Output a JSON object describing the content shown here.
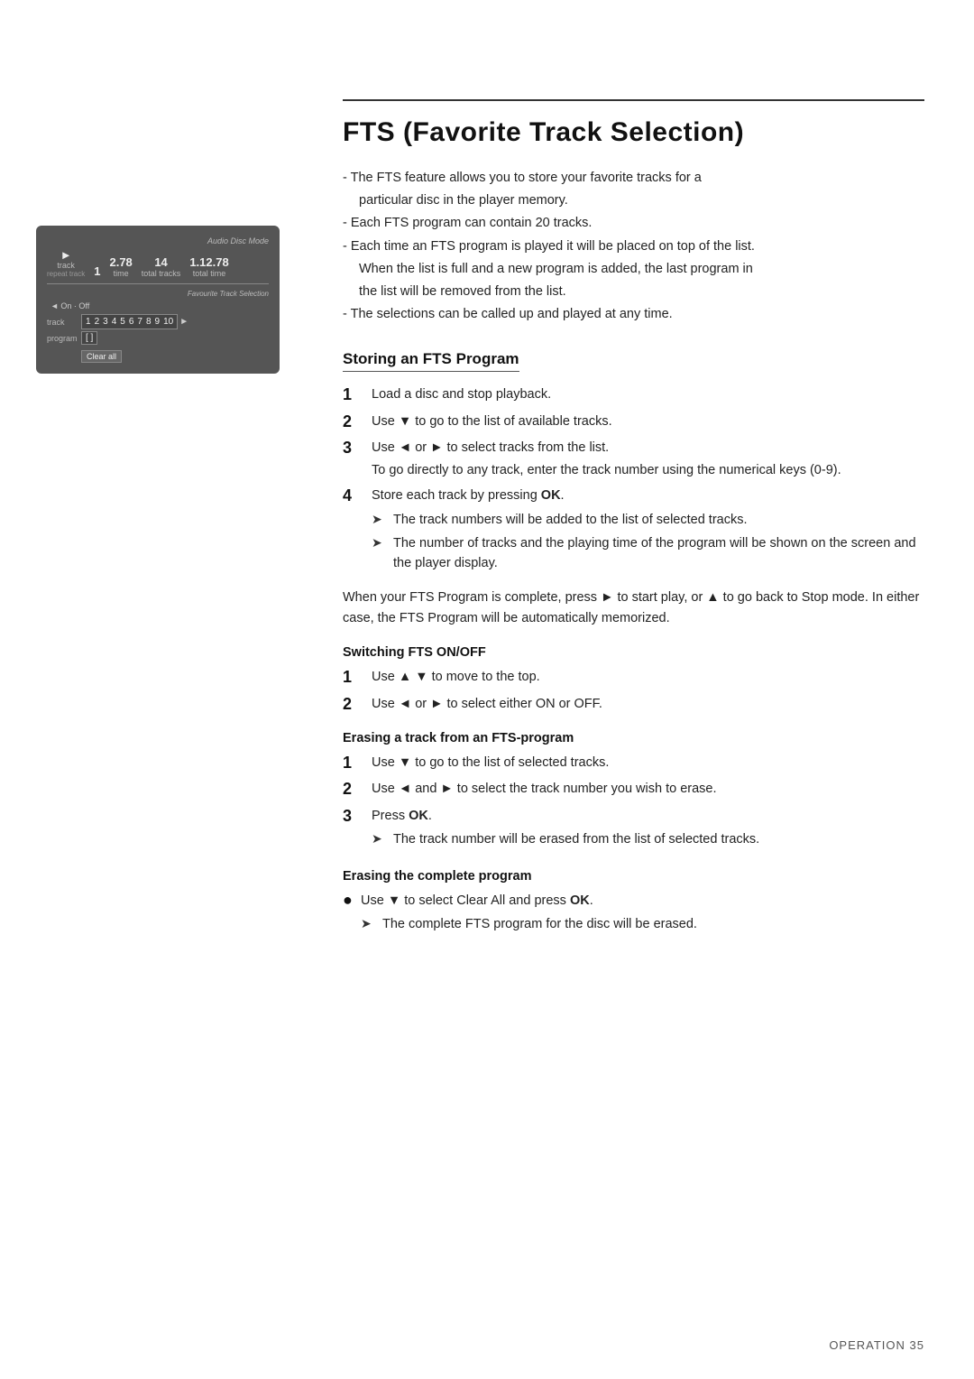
{
  "page": {
    "title": "FTS (Favorite Track Selection)",
    "page_number": "OPERATION 35"
  },
  "intro": {
    "bullets": [
      "- The FTS feature allows you to store your favorite tracks for a",
      "  particular disc in the player memory.",
      "- Each FTS program can contain 20 tracks.",
      "- Each time an FTS program is played it will be placed on top of the list.",
      "  When the list is full and a new program is added, the last program in",
      "  the list will be removed from the list.",
      "- The selections can be called up and played at any time."
    ]
  },
  "storing_section": {
    "title": "Storing an FTS Program",
    "steps": [
      {
        "num": "1",
        "text": "Load a disc and stop playback."
      },
      {
        "num": "2",
        "text": "Use ▼ to go to the list of available tracks."
      },
      {
        "num": "3",
        "text": "Use ◄ or ► to select tracks from the list.",
        "sub": "To go directly to any track, enter the track number using the numerical keys (0-9)."
      },
      {
        "num": "4",
        "text": "Store each track by pressing OK.",
        "arrows": [
          "The track numbers will be added to the list of selected tracks.",
          "The number of tracks and the playing time of the program will be shown on the screen and the player display."
        ]
      }
    ],
    "paragraph": "When your FTS Program is complete, press ► to start play, or ▲ to go back to Stop mode. In either case, the FTS Program will be automatically memorized."
  },
  "switching_section": {
    "title": "Switching FTS ON/OFF",
    "steps": [
      {
        "num": "1",
        "text": "Use ▲ ▼ to move to the top."
      },
      {
        "num": "2",
        "text": "Use ◄ or ► to select either ON or OFF."
      }
    ]
  },
  "erasing_track_section": {
    "title": "Erasing a track from an FTS-program",
    "steps": [
      {
        "num": "1",
        "text": "Use ▼ to go to the list of selected tracks."
      },
      {
        "num": "2",
        "text": "Use ◄ and ► to select the track number you wish to erase."
      },
      {
        "num": "3",
        "text": "Press OK.",
        "arrows": [
          "The track number will be erased from the list of selected tracks."
        ]
      }
    ]
  },
  "erasing_complete_section": {
    "title": "Erasing the complete program",
    "bullet": "Use ▼ to select Clear All and press OK.",
    "arrow": "The complete FTS program for the disc will be erased."
  },
  "device_screen": {
    "mode_label": "Audio Disc Mode",
    "play_symbol": "►",
    "track_value": "1",
    "track_label": "track",
    "time_value": "2.78",
    "time_label": "time",
    "total_tracks_value": "14",
    "total_tracks_label": "total tracks",
    "total_time_value": "1.12.78",
    "total_time_label": "total time",
    "repeat_label": "repeat track",
    "fts_label": "Favourite Track Selection",
    "onoff_label": "◄ On · Off",
    "track_row_label": "track",
    "numbers": [
      "1",
      "2",
      "3",
      "4",
      "5",
      "6",
      "7",
      "8",
      "9",
      "10"
    ],
    "more_arrow": "►",
    "program_label": "program",
    "program_value": "[ ]",
    "clearall_label": "Clear all"
  }
}
